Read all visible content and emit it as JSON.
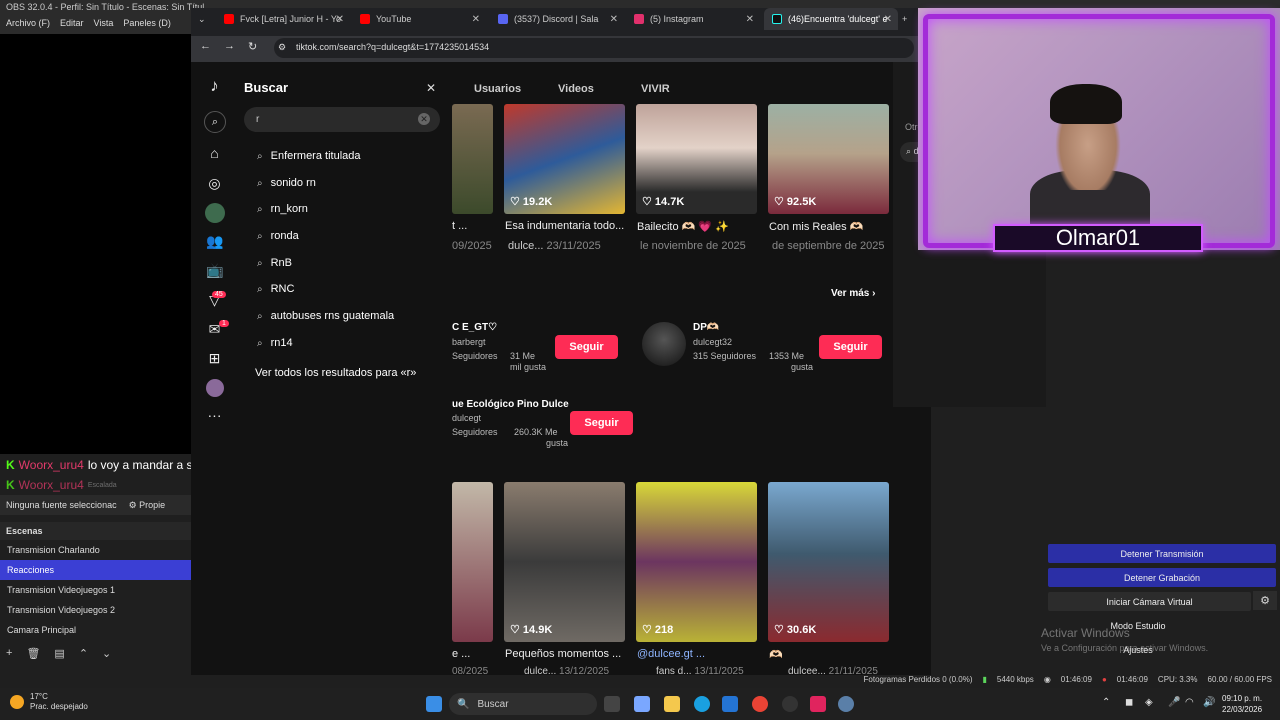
{
  "obs": {
    "title": "OBS 32.0.4 - Perfil: Sin Título - Escenas: Sin Títul",
    "menu": [
      "Archivo (F)",
      "Editar",
      "Vista",
      "Paneles (D)"
    ],
    "source_bar": {
      "text": "Ninguna fuente seleccionac",
      "props": "Propie"
    },
    "scenes_header": "Escenas",
    "scenes": [
      "Transmision Charlando",
      "Reacciones",
      "Transmision Videojuegos 1",
      "Transmision Videojuegos 2",
      "Camara Principal"
    ],
    "controls": [
      "Detener Transmisión",
      "Detener Grabación",
      "Iniciar Cámara Virtual",
      "Modo Estudio",
      "Ajustes"
    ],
    "watermark": {
      "title": "Activar Windows",
      "sub": "Ve a Configuración para activar Windows."
    },
    "status": {
      "dropped": "Fotogramas Perdidos 0 (0.0%)",
      "kbps": "5440 kbps",
      "stream_time": "01:46:09",
      "rec_time": "01:46:09",
      "cpu": "CPU: 3.3%",
      "fps": "60.00 / 60.00 FPS"
    }
  },
  "chat": {
    "user": "Woorx_uru4",
    "message": "lo voy a mandar a secuestrar",
    "user2": "Woorx_uru4",
    "tiny": "Escalada"
  },
  "browser": {
    "tabs": [
      {
        "title": "Fvck [Letra] Junior H - Yo",
        "color": "#ff0000"
      },
      {
        "title": "YouTube",
        "color": "#ff0000"
      },
      {
        "title": "(3537) Discord | Sala",
        "color": "#5865f2"
      },
      {
        "title": "(5) Instagram",
        "color": "#e1306c"
      },
      {
        "title": "(46)Encuentra 'dulcegt' e",
        "color": "#111111"
      }
    ],
    "url": "tiktok.com/search?q=dulcegt&t=1774235014534"
  },
  "tiktok": {
    "tabs": [
      "Usuarios",
      "Videos",
      "VIVIR"
    ],
    "others_label": "Otros",
    "others_search": "du",
    "panel_title": "Buscar",
    "search_value": "r",
    "suggestions": [
      "Enfermera titulada",
      "sonido rn",
      "rn_korn",
      "ronda",
      "RnB",
      "RNC",
      "autobuses rns guatemala",
      "rn14"
    ],
    "see_all": "Ver todos los resultados para «r»",
    "top_videos": [
      {
        "likes": "",
        "caption": "t ...",
        "meta": "09/2025"
      },
      {
        "likes": "19.2K",
        "caption": "Esa indumentaria todo...",
        "meta_user": "dulce...",
        "meta": "23/11/2025"
      },
      {
        "likes": "14.7K",
        "caption": "Bailecito 🫶🏻 💗 ✨",
        "meta": "le noviembre de 2025"
      },
      {
        "likes": "92.5K",
        "caption": "Con mis Reales 🫶🏻",
        "meta": "de septiembre de 2025"
      }
    ],
    "ver_mas": "Ver más",
    "accounts": [
      {
        "name": "C E_GT♡",
        "handle": "barbergt",
        "followers": "Seguidores",
        "likes": "31 Me",
        "likes2": "mil gusta",
        "button": "Seguir"
      },
      {
        "name": "DP🫶🏻",
        "handle": "dulcegt32",
        "followers": "315 Seguidores",
        "likes": "1353 Me",
        "likes2": "gusta",
        "button": "Seguir"
      },
      {
        "name": "ue Ecológico Pino Dulce",
        "handle": "dulcegt",
        "followers": "Seguidores",
        "likes": "260.3K Me",
        "likes2": "gusta",
        "button": "Seguir"
      }
    ],
    "bottom_videos": [
      {
        "likes": "",
        "caption": "e ...",
        "meta": "08/2025"
      },
      {
        "likes": "14.9K",
        "caption": "Pequeños momentos ...",
        "meta_user": "dulce...",
        "meta": "13/12/2025"
      },
      {
        "likes": "218",
        "caption": "@dulcee.gt ...",
        "meta_user": "fans d...",
        "meta": "13/11/2025"
      },
      {
        "likes": "30.6K",
        "caption": "🫶🏻",
        "meta_user": "dulcee...",
        "meta": "21/11/2025"
      }
    ],
    "nav_badges": {
      "inbox": "45",
      "messages": "1"
    }
  },
  "webcam": {
    "name": "Olmar01"
  },
  "taskbar": {
    "weather_temp": "17°C",
    "weather_desc": "Prac. despejado",
    "search": "Buscar",
    "time": "09:10 p. m.",
    "date": "22/03/2026"
  }
}
